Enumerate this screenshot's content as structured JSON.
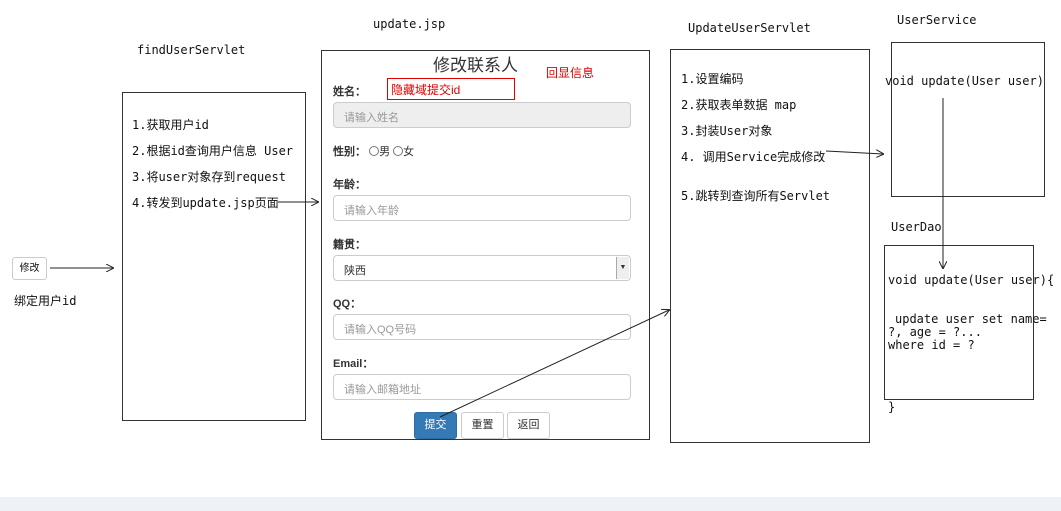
{
  "titles": {
    "find_servlet": "findUserServlet",
    "update_jsp": "update.jsp",
    "update_servlet": "UpdateUserServlet",
    "user_service": "UserService",
    "user_dao": "UserDao"
  },
  "left": {
    "modify_button": "修改",
    "bind_label": "绑定用户id"
  },
  "find_steps": [
    "1.获取用户id",
    "2.根据id查询用户信息 User",
    "3.将user对象存到request",
    "4.转发到update.jsp页面"
  ],
  "form": {
    "heading": "修改联系人",
    "hidden_note": "隐藏域提交id",
    "echo_note": "回显信息",
    "name_label": "姓名：",
    "name_placeholder": "请输入姓名",
    "gender_label": "性别：",
    "gender_male": "男",
    "gender_female": "女",
    "age_label": "年龄：",
    "age_placeholder": "请输入年龄",
    "native_label": "籍贯：",
    "native_value": "陕西",
    "qq_label": "QQ：",
    "qq_placeholder": "请输入QQ号码",
    "email_label": "Email：",
    "email_placeholder": "请输入邮箱地址",
    "submit": "提交",
    "reset": "重置",
    "back": "返回"
  },
  "update_steps": [
    "1.设置编码",
    "2.获取表单数据 map",
    "3.封装User对象",
    "4. 调用Service完成修改",
    "5.跳转到查询所有Servlet"
  ],
  "service_method": "void update(User user)",
  "dao": {
    "method": "void update(User user){",
    "sql_line1": "update user set name=",
    "sql_line2": "?, age = ?...",
    "sql_line3": "where id = ?",
    "close": "}"
  },
  "colors": {
    "accent": "#337ab7",
    "annotation_red": "#e00000"
  }
}
